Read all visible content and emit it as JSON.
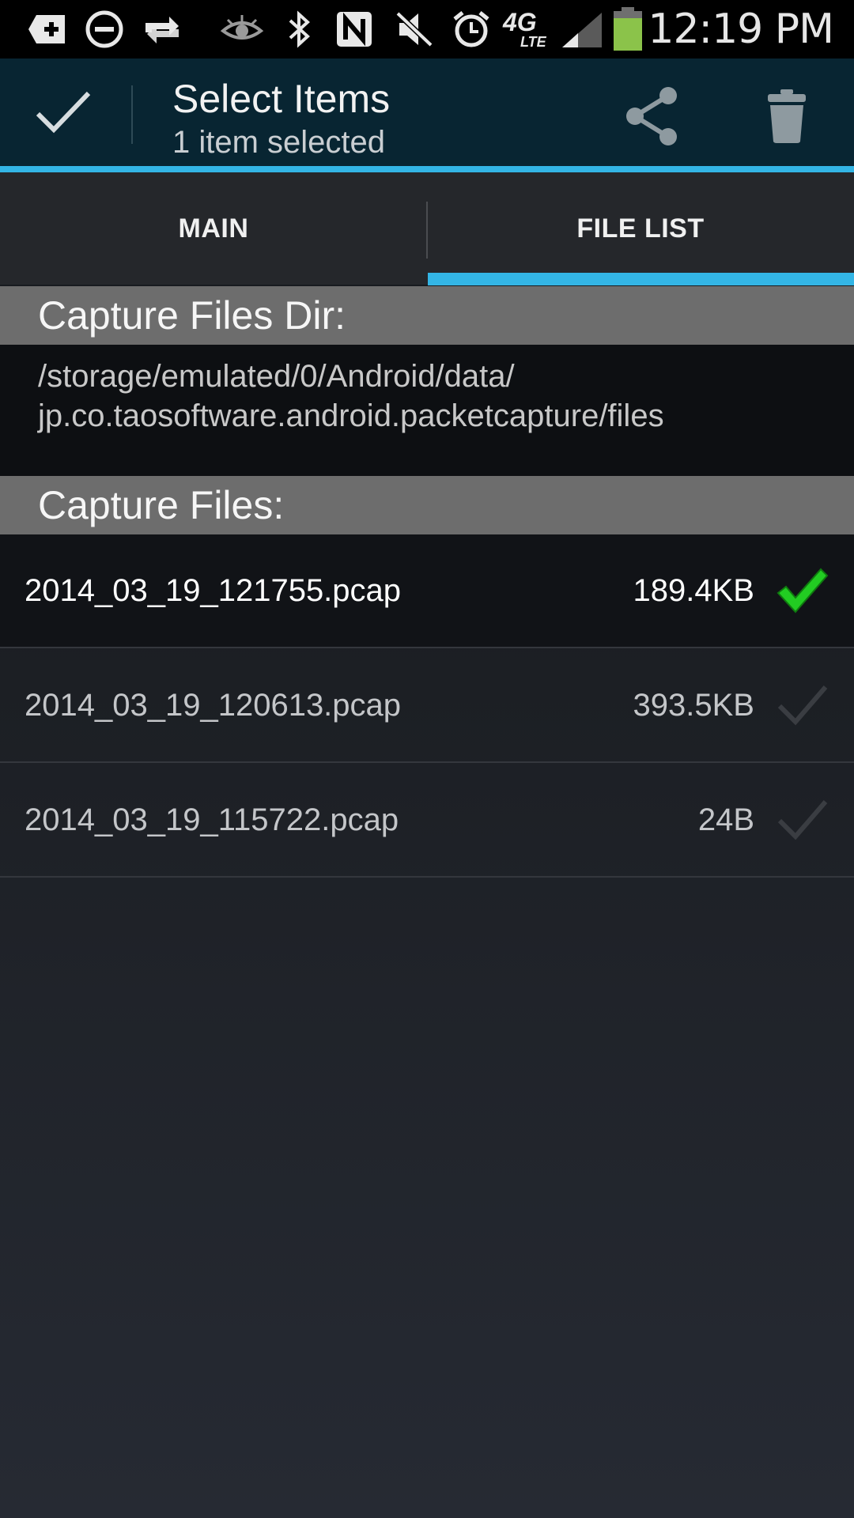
{
  "status_bar": {
    "time": "12:19 PM",
    "network_label": "4G",
    "network_sub": "LTE",
    "icons": [
      "add-box-icon",
      "do-not-disturb-icon",
      "sync-icon",
      "eye-icon",
      "bluetooth-icon",
      "nfc-icon",
      "mute-icon",
      "alarm-icon",
      "network-4g-lte-icon",
      "signal-icon",
      "battery-icon"
    ],
    "battery_color": "#8bc34a"
  },
  "action_bar": {
    "title": "Select Items",
    "subtitle": "1 item selected",
    "icons": [
      "checkmark-icon",
      "share-icon",
      "trash-icon"
    ],
    "accent": "#33b5e5"
  },
  "tabs": [
    {
      "label": "MAIN",
      "selected": false
    },
    {
      "label": "FILE LIST",
      "selected": true
    }
  ],
  "capture_dir": {
    "header": "Capture Files Dir:",
    "path_line1": "/storage/emulated/0/Android/data/",
    "path_line2": "jp.co.taosoftware.android.packetcapture/files"
  },
  "capture_files": {
    "header": "Capture Files:",
    "files": [
      {
        "name": "2014_03_19_121755.pcap",
        "size": "189.4KB",
        "selected": true
      },
      {
        "name": "2014_03_19_120613.pcap",
        "size": "393.5KB",
        "selected": false
      },
      {
        "name": "2014_03_19_115722.pcap",
        "size": "24B",
        "selected": false
      }
    ]
  },
  "colors": {
    "selected_check": "#22cc22",
    "unselected_check": "#3a3d42"
  }
}
